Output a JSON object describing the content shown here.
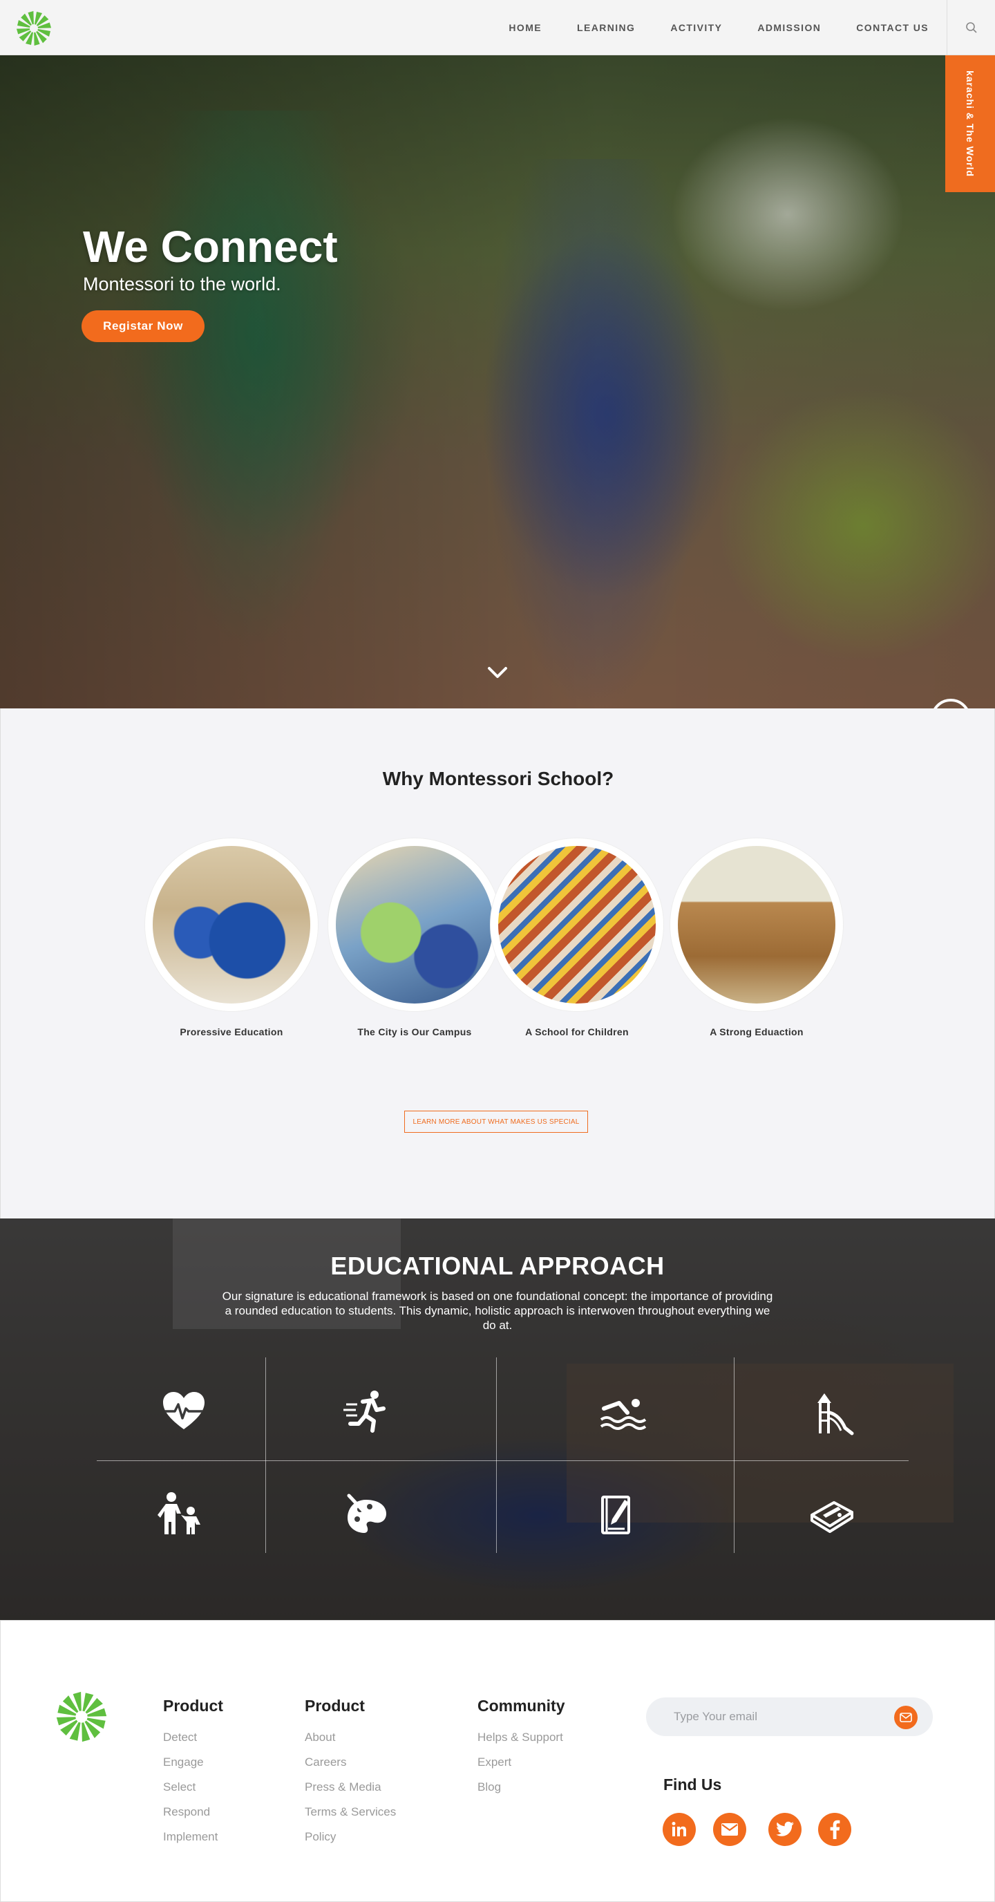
{
  "header": {
    "nav": [
      "HOME",
      "LEARNING",
      "ACTIVITY",
      "ADMISSION",
      "CONTACT US"
    ],
    "side_tab": "karachi & The World",
    "icons": {
      "logo": "pinwheel-logo",
      "search": "search-icon"
    }
  },
  "hero": {
    "title": "We Connect",
    "subtitle": "Montessori to the world.",
    "cta": "Registar Now",
    "icons": {
      "scroll": "chevron-down-icon",
      "play": "play-circle-icon"
    }
  },
  "why": {
    "title": "Why Montessori School?",
    "cards": [
      {
        "label": "Proressive Education"
      },
      {
        "label": "The City is Our Campus"
      },
      {
        "label": "A School for Children"
      },
      {
        "label": "A Strong Eduaction"
      }
    ],
    "learn_more": "LEARN MORE ABOUT WHAT MAKES US SPECIAL"
  },
  "approach": {
    "title": "EDUCATIONAL APPROACH",
    "text": "Our signature is educational framework is based on one foundational concept: the importance of providing a rounded education to students. This dynamic, holistic approach is interwoven throughout everything we do at.",
    "icons": [
      "heart-pulse-icon",
      "runner-icon",
      "swimmer-icon",
      "playground-slide-icon",
      "parent-child-icon",
      "paint-palette-icon",
      "book-pencil-icon",
      "pencil-box-icon"
    ]
  },
  "footer": {
    "columns": [
      {
        "title": "Product",
        "links": [
          "Detect",
          "Engage",
          "Select",
          "Respond",
          "Implement"
        ]
      },
      {
        "title": "Product",
        "links": [
          "About",
          "Careers",
          "Press & Media",
          "Terms & Services",
          "Policy"
        ]
      },
      {
        "title": "Community",
        "links": [
          "Helps & Support",
          "Expert",
          "Blog"
        ]
      }
    ],
    "email_placeholder": "Type Your email",
    "find_us": "Find Us",
    "social": [
      "linkedin-icon",
      "mail-icon",
      "twitter-icon",
      "facebook-icon"
    ]
  },
  "colors": {
    "accent": "#f26b1d",
    "logo_green": "#5fbf3f",
    "text_dark": "#222222",
    "text_muted": "#9a9a9a"
  }
}
